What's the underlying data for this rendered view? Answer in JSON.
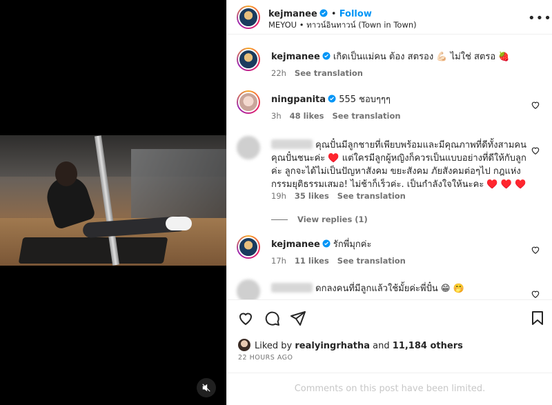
{
  "post": {
    "author": "kejmanee",
    "follow_label": "Follow",
    "location": "MEYOU • ทาวน์อินทาวน์ (Town in Town)",
    "more_label": "•••",
    "caption": "เกิดเป็นแม่คน ต้อง สตรอง 💪🏻 ไม่ใช่ สตรอ 🍓",
    "caption_time": "22h",
    "see_translation": "See translation"
  },
  "comments": [
    {
      "user": "ningpanita",
      "text": "555 ชอบๆๆๆ",
      "time": "3h",
      "likes": "48 likes",
      "see_translation": "See translation"
    },
    {
      "user": "",
      "text": "คุณปั๋นมีลูกชายที่เพียบพร้อมและมีคุณภาพที่ดีทั้งสามคน คุณปั๋นชนะค่ะ ♥️ แต่ใครมีลูกผู้หญิงก็ควรเป็นแบบอย่างที่ดีให้กับลูกค่ะ ลูกจะได้ไม่เป็นปัญหาสังคม ขยะสังคม ภัยสังคมต่อๆไป กฎแห่งกรรมยุติธรรมเสมอ! ไม่ช้าก็เร็วค่ะ. เป็นกำลังใจให้นะคะ ♥️ ♥️ ♥️",
      "time": "19h",
      "likes": "35 likes",
      "see_translation": "See translation",
      "view_replies": "View replies (1)"
    },
    {
      "user": "kejmanee",
      "text": "รักพี่มุกค่ะ",
      "time": "17h",
      "likes": "11 likes",
      "see_translation": "See translation"
    },
    {
      "user": "",
      "text": "ดกลงคนที่มีลูกแล้วใช้มั้ยค่ะพี่ปั๋น 😁 🤭"
    }
  ],
  "likes": {
    "prefix": "Liked by",
    "user": "realyingrhatha",
    "and": "and",
    "others": "11,184 others"
  },
  "timestamp": "22 HOURS AGO",
  "limited_notice": "Comments on this post have been limited.",
  "colors": {
    "accent": "#0095f6",
    "muted": "#737373",
    "verified": "#0095f6"
  },
  "icons": [
    "heart-icon",
    "comment-icon",
    "share-icon",
    "bookmark-icon",
    "mute-icon",
    "verified-icon"
  ]
}
